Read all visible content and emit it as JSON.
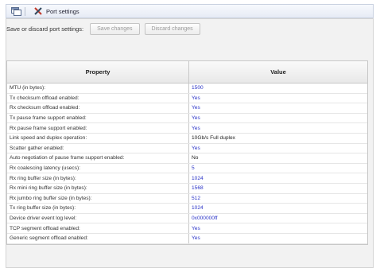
{
  "window": {
    "title": "Port settings"
  },
  "toolbar": {
    "label": "Save or discard port settings:",
    "save_label": "Save changes",
    "discard_label": "Discard changes"
  },
  "table": {
    "headers": {
      "property": "Property",
      "value": "Value"
    },
    "rows": [
      {
        "property": "MTU (in bytes):",
        "value": "1500",
        "value_color": "blue"
      },
      {
        "property": "Tx checksum offload enabled:",
        "value": "Yes",
        "value_color": "blue"
      },
      {
        "property": "Rx checksum offload enabled:",
        "value": "Yes",
        "value_color": "blue"
      },
      {
        "property": "Tx pause frame support enabled:",
        "value": "Yes",
        "value_color": "blue"
      },
      {
        "property": "Rx pause frame support enabled:",
        "value": "Yes",
        "value_color": "blue"
      },
      {
        "property": "Link speed and duplex operation:",
        "value": "10Gb/s Full duplex",
        "value_color": "black"
      },
      {
        "property": "Scatter gather enabled:",
        "value": "Yes",
        "value_color": "blue"
      },
      {
        "property": "Auto negotiation of pause frame support enabled:",
        "value": "No",
        "value_color": "black"
      },
      {
        "property": "Rx coalescing latency (usecs):",
        "value": "5",
        "value_color": "blue"
      },
      {
        "property": "Rx ring buffer size (in bytes):",
        "value": "1024",
        "value_color": "blue"
      },
      {
        "property": "Rx mini ring buffer size (in bytes):",
        "value": "1568",
        "value_color": "blue"
      },
      {
        "property": "Rx jumbo ring buffer size (in bytes):",
        "value": "512",
        "value_color": "blue"
      },
      {
        "property": "Tx ring buffer size (in bytes):",
        "value": "1024",
        "value_color": "blue"
      },
      {
        "property": "Device driver event log level:",
        "value": "0x000000ff",
        "value_color": "blue"
      },
      {
        "property": "TCP segment offload enabled:",
        "value": "Yes",
        "value_color": "blue"
      },
      {
        "property": "Generic segment offload enabled:",
        "value": "Yes",
        "value_color": "blue"
      }
    ]
  },
  "colors": {
    "value_blue": "#2a33c7",
    "title_bar": "#e6ebf5",
    "panel_bg": "#f2f2f2"
  },
  "icons": [
    "window-icon",
    "tools-icon"
  ]
}
